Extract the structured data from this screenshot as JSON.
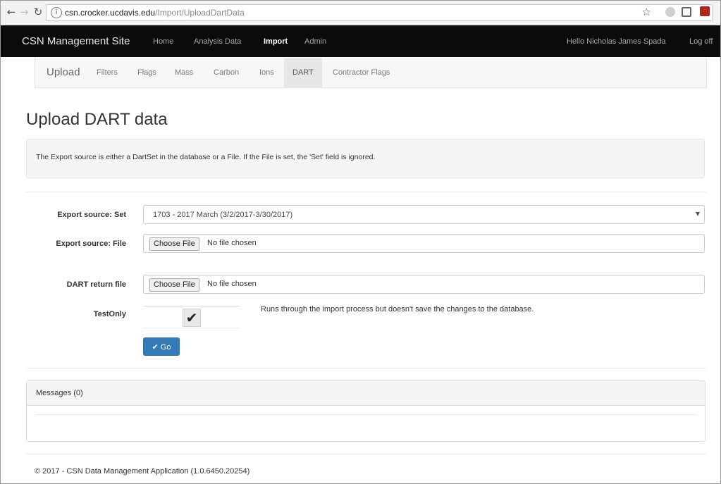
{
  "browser": {
    "url_host": "csn.crocker.ucdavis.edu",
    "url_path": "/Import/UploadDartData"
  },
  "navbar": {
    "brand": "CSN Management Site",
    "items": [
      {
        "label": "Home"
      },
      {
        "label": "Analysis Data"
      },
      {
        "label": "Import"
      },
      {
        "label": "Admin"
      }
    ],
    "greeting": "Hello Nicholas James Spada",
    "logoff": "Log off"
  },
  "subnav": {
    "items": [
      {
        "label": "Upload"
      },
      {
        "label": "Filters"
      },
      {
        "label": "Flags"
      },
      {
        "label": "Mass"
      },
      {
        "label": "Carbon"
      },
      {
        "label": "Ions"
      },
      {
        "label": "DART"
      },
      {
        "label": "Contractor Flags"
      }
    ]
  },
  "page": {
    "title": "Upload DART data",
    "info": "The Export source is either a DartSet in the database or a File. If the File is set, the 'Set' field is ignored."
  },
  "form": {
    "set_label": "Export source: Set",
    "set_value": "1703 - 2017 March (3/2/2017-3/30/2017)",
    "file_label": "Export source: File",
    "file_button": "Choose File",
    "file_status": "No file chosen",
    "return_label": "DART return file",
    "return_button": "Choose File",
    "return_status": "No file chosen",
    "testonly_label": "TestOnly",
    "testonly_checked": true,
    "testonly_help": "Runs through the import process but doesn't save the changes to the database.",
    "go_label": "Go"
  },
  "messages": {
    "header": "Messages (0)"
  },
  "footer": {
    "text": "© 2017 - CSN Data Management Application (1.0.6450.20254)"
  }
}
